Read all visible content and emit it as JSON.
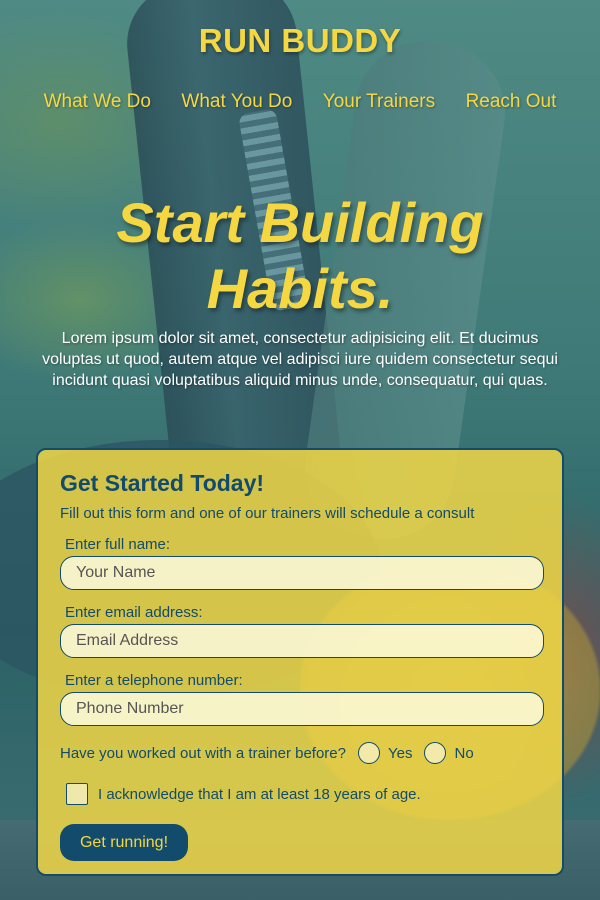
{
  "brand": "RUN BUDDY",
  "nav": {
    "items": [
      "What We Do",
      "What You Do",
      "Your Trainers",
      "Reach Out"
    ]
  },
  "hero": {
    "title_line1": "Start Building",
    "title_line2": "Habits.",
    "body": "Lorem ipsum dolor sit amet, consectetur adipisicing elit. Et ducimus voluptas ut quod, autem atque vel adipisci iure quidem consectetur sequi incidunt quasi voluptatibus aliquid minus unde, consequatur, qui quas."
  },
  "form": {
    "title": "Get Started Today!",
    "subtitle": "Fill out this form and one of our trainers will schedule a consult",
    "name_label": "Enter full name:",
    "name_placeholder": "Your Name",
    "email_label": "Enter email address:",
    "email_placeholder": "Email Address",
    "phone_label": "Enter a telephone number:",
    "phone_placeholder": "Phone Number",
    "trainer_question": "Have you worked out with a trainer before?",
    "yes_label": "Yes",
    "no_label": "No",
    "age_ack": "I acknowledge that I am at least 18 years of age.",
    "submit_label": "Get running!"
  },
  "colors": {
    "accent_yellow": "#f5d742",
    "navy": "#124b6b"
  }
}
